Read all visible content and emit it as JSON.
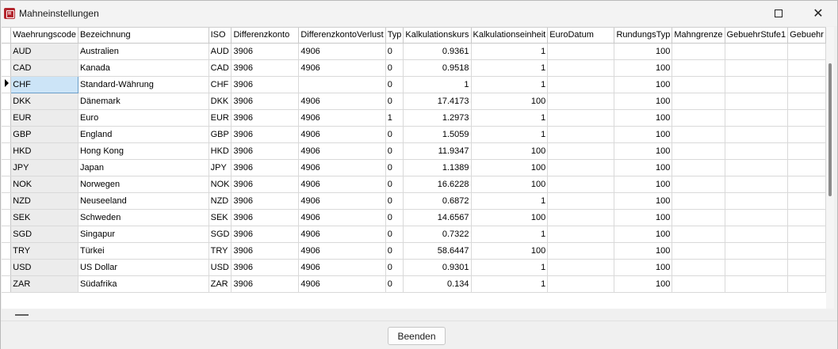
{
  "window": {
    "title": "Mahneinstellungen",
    "close_glyph": "✕"
  },
  "grid": {
    "columns": [
      "Waehrungscode",
      "Bezeichnung",
      "ISO",
      "Differenzkonto",
      "DifferenzkontoVerlust",
      "Typ",
      "Kalkulationskurs",
      "Kalkulationseinheit",
      "EuroDatum",
      "RundungsTyp",
      "Mahngrenze",
      "GebuehrStufe1",
      "Gebuehr"
    ],
    "current_row": 2,
    "rows": [
      [
        "AUD",
        "Australien",
        "AUD",
        "3906",
        "4906",
        "0",
        "0.9361",
        "1",
        "",
        "100",
        "",
        "",
        ""
      ],
      [
        "CAD",
        "Kanada",
        "CAD",
        "3906",
        "4906",
        "0",
        "0.9518",
        "1",
        "",
        "100",
        "",
        "",
        ""
      ],
      [
        "CHF",
        "Standard-Währung",
        "CHF",
        "3906",
        "",
        "0",
        "1",
        "1",
        "",
        "100",
        "",
        "",
        ""
      ],
      [
        "DKK",
        "Dänemark",
        "DKK",
        "3906",
        "4906",
        "0",
        "17.4173",
        "100",
        "",
        "100",
        "",
        "",
        ""
      ],
      [
        "EUR",
        "Euro",
        "EUR",
        "3906",
        "4906",
        "1",
        "1.2973",
        "1",
        "",
        "100",
        "",
        "",
        ""
      ],
      [
        "GBP",
        "England",
        "GBP",
        "3906",
        "4906",
        "0",
        "1.5059",
        "1",
        "",
        "100",
        "",
        "",
        ""
      ],
      [
        "HKD",
        "Hong Kong",
        "HKD",
        "3906",
        "4906",
        "0",
        "11.9347",
        "100",
        "",
        "100",
        "",
        "",
        ""
      ],
      [
        "JPY",
        "Japan",
        "JPY",
        "3906",
        "4906",
        "0",
        "1.1389",
        "100",
        "",
        "100",
        "",
        "",
        ""
      ],
      [
        "NOK",
        "Norwegen",
        "NOK",
        "3906",
        "4906",
        "0",
        "16.6228",
        "100",
        "",
        "100",
        "",
        "",
        ""
      ],
      [
        "NZD",
        "Neuseeland",
        "NZD",
        "3906",
        "4906",
        "0",
        "0.6872",
        "1",
        "",
        "100",
        "",
        "",
        ""
      ],
      [
        "SEK",
        "Schweden",
        "SEK",
        "3906",
        "4906",
        "0",
        "14.6567",
        "100",
        "",
        "100",
        "",
        "",
        ""
      ],
      [
        "SGD",
        "Singapur",
        "SGD",
        "3906",
        "4906",
        "0",
        "0.7322",
        "1",
        "",
        "100",
        "",
        "",
        ""
      ],
      [
        "TRY",
        "Türkei",
        "TRY",
        "3906",
        "4906",
        "0",
        "58.6447",
        "100",
        "",
        "100",
        "",
        "",
        ""
      ],
      [
        "USD",
        "US Dollar",
        "USD",
        "3906",
        "4906",
        "0",
        "0.9301",
        "1",
        "",
        "100",
        "",
        "",
        ""
      ],
      [
        "ZAR",
        "Südafrika",
        "ZAR",
        "3906",
        "4906",
        "0",
        "0.134",
        "1",
        "",
        "100",
        "",
        "",
        ""
      ]
    ]
  },
  "footer": {
    "close_button_label": "Beenden"
  },
  "icons": {
    "app": "document-list-icon",
    "maximize": "maximize-icon",
    "close": "close-icon",
    "row_indicator": "current-row-arrow-icon"
  }
}
